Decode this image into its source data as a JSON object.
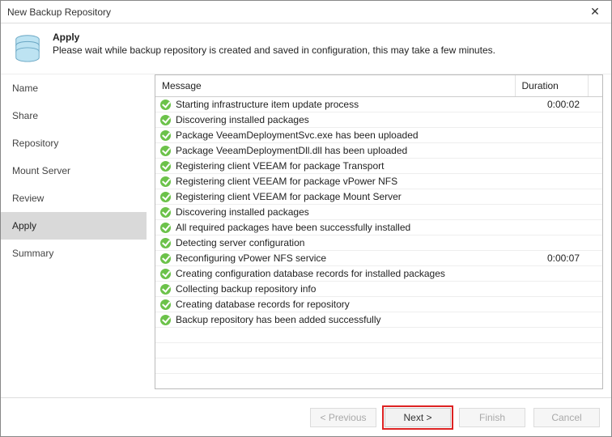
{
  "window": {
    "title": "New Backup Repository"
  },
  "header": {
    "step_title": "Apply",
    "step_desc": "Please wait while backup repository is created and saved in configuration, this may take a few minutes."
  },
  "sidebar": {
    "items": [
      {
        "label": "Name",
        "current": false
      },
      {
        "label": "Share",
        "current": false
      },
      {
        "label": "Repository",
        "current": false
      },
      {
        "label": "Mount Server",
        "current": false
      },
      {
        "label": "Review",
        "current": false
      },
      {
        "label": "Apply",
        "current": true
      },
      {
        "label": "Summary",
        "current": false
      }
    ]
  },
  "log_table": {
    "columns": {
      "message": "Message",
      "duration": "Duration"
    },
    "rows": [
      {
        "status": "ok",
        "message": "Starting infrastructure item update process",
        "duration": "0:00:02"
      },
      {
        "status": "ok",
        "message": "Discovering installed packages",
        "duration": ""
      },
      {
        "status": "ok",
        "message": "Package VeeamDeploymentSvc.exe has been uploaded",
        "duration": ""
      },
      {
        "status": "ok",
        "message": "Package VeeamDeploymentDll.dll has been uploaded",
        "duration": ""
      },
      {
        "status": "ok",
        "message": "Registering client VEEAM for package Transport",
        "duration": ""
      },
      {
        "status": "ok",
        "message": "Registering client VEEAM for package vPower NFS",
        "duration": ""
      },
      {
        "status": "ok",
        "message": "Registering client VEEAM for package Mount Server",
        "duration": ""
      },
      {
        "status": "ok",
        "message": "Discovering installed packages",
        "duration": ""
      },
      {
        "status": "ok",
        "message": "All required packages have been successfully installed",
        "duration": ""
      },
      {
        "status": "ok",
        "message": "Detecting server configuration",
        "duration": ""
      },
      {
        "status": "ok",
        "message": "Reconfiguring vPower NFS service",
        "duration": "0:00:07"
      },
      {
        "status": "ok",
        "message": "Creating configuration database records for installed packages",
        "duration": ""
      },
      {
        "status": "ok",
        "message": "Collecting backup repository info",
        "duration": ""
      },
      {
        "status": "ok",
        "message": "Creating database records for repository",
        "duration": ""
      },
      {
        "status": "ok",
        "message": "Backup repository has been added successfully",
        "duration": ""
      }
    ],
    "empty_rows": 3
  },
  "footer": {
    "previous": "< Previous",
    "next": "Next >",
    "finish": "Finish",
    "cancel": "Cancel",
    "previous_enabled": false,
    "next_enabled": true,
    "finish_enabled": false,
    "cancel_enabled": false
  }
}
